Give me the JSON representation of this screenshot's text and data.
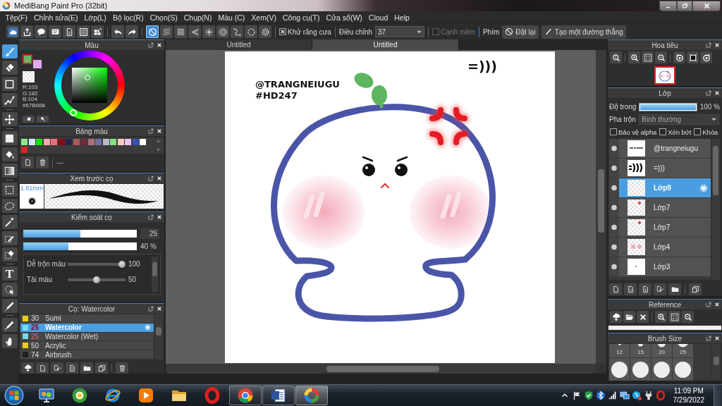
{
  "window": {
    "title": "MediBang Paint Pro (32bit)"
  },
  "menu": [
    "Tệp(F)",
    "Chỉnh sửa(E)",
    "Lớp(L)",
    "Bộ lọc(R)",
    "Chọn(S)",
    "Chụp(N)",
    "Màu (C)",
    "Xem(V)",
    "Công cụ(T)",
    "Cửa sổ(W)",
    "Cloud",
    "Help"
  ],
  "toolbar": {
    "snaps": [
      {
        "selected": true
      },
      {
        "selected": false
      },
      {
        "selected": false
      },
      {
        "selected": false
      },
      {
        "selected": false
      },
      {
        "selected": false
      },
      {
        "selected": false
      },
      {
        "selected": false
      },
      {
        "selected": false
      }
    ],
    "antialias": {
      "label": "Khử răng cưa",
      "checked": true
    },
    "correction": {
      "label": "Điều chỉnh",
      "value": "37"
    },
    "soft_edge": {
      "label": "Cạnh mềm",
      "checked": false,
      "disabled": true
    },
    "keys_label": "Phím",
    "reset_button": "Đặt lại",
    "line_button": "Tạo một đường thẳng"
  },
  "tools": {
    "groups": [
      [
        {
          "selected": true
        },
        {
          "selected": false
        },
        {
          "selected": false
        },
        {
          "selected": false
        }
      ],
      [
        {
          "selected": false
        }
      ],
      [
        {
          "selected": false
        },
        {
          "selected": false
        },
        {
          "selected": false
        }
      ],
      [
        {
          "selected": false
        },
        {
          "selected": false
        },
        {
          "selected": false
        },
        {
          "selected": false
        },
        {
          "selected": false
        }
      ],
      [
        {
          "selected": false,
          "glyph": "T"
        },
        {
          "selected": false
        },
        {
          "selected": false
        }
      ],
      [
        {
          "selected": false
        },
        {
          "selected": false
        }
      ]
    ]
  },
  "color_panel": {
    "title": "Màu",
    "foreground": {
      "color": "#67b668",
      "selected": true
    },
    "background": {
      "color": "#e0a8f0",
      "selected": false
    },
    "readout": [
      "R:103",
      "G:182",
      "B:104",
      "#67B668"
    ]
  },
  "palette": {
    "title": "Bảng màu",
    "swatches": [
      {
        "color": "#8fe88f"
      },
      {
        "color": "#d4eafa"
      },
      {
        "color": "#10e010"
      },
      {
        "color": "#f4a8b0"
      },
      {
        "color": "#e8707c"
      },
      {
        "color": "#8a0a14"
      },
      {
        "color": "#23234e"
      },
      {
        "color": "#a85a5a"
      },
      {
        "color": "#6e2c36"
      },
      {
        "color": "#a87272"
      },
      {
        "color": "#7070a0"
      },
      {
        "color": "#b8b8c8"
      },
      {
        "color": "#84e484"
      },
      {
        "color": "#fcccc4"
      },
      {
        "color": "#e8c4f4"
      },
      {
        "color": "#3454b4"
      },
      {
        "color": "#ffffff"
      },
      {
        "color": "#d42828"
      }
    ],
    "name": "---"
  },
  "brush_preview": {
    "title": "Xem trước cọ",
    "size": "1.81mm"
  },
  "brush_control": {
    "title": "Kiểm soát cọ",
    "size": {
      "level": 0.5,
      "value": "25"
    },
    "opacity": {
      "level": 0.4,
      "value": "40 %"
    },
    "params": [
      {
        "label": "Dễ trộn màu",
        "level": 1,
        "value": "100"
      },
      {
        "label": "Tải màu",
        "level": 0.5,
        "value": "50"
      }
    ]
  },
  "brushes": {
    "title": "Cọ: Watercolor",
    "items": [
      {
        "size": "30",
        "name": "Sumi",
        "color": "#e8d010",
        "size_marked": false,
        "selected": false
      },
      {
        "size": "25",
        "name": "Watercolor",
        "color": "#7ad8f0",
        "size_marked": true,
        "selected": true
      },
      {
        "size": "25",
        "name": "Watercolor (Wet)",
        "color": "#7ad8f0",
        "size_marked": true,
        "selected": false
      },
      {
        "size": "50",
        "name": "Acrylic",
        "color": "#e8d010",
        "size_marked": false,
        "selected": false
      },
      {
        "size": "74",
        "name": "Airbrush",
        "color": "#1e1e1e",
        "size_marked": false,
        "selected": false
      }
    ]
  },
  "tabs": [
    {
      "label": "Untitled",
      "selected": false
    },
    {
      "label": "Untitled",
      "selected": true
    }
  ],
  "canvas": {
    "handle": "@TRANGNEIUGU",
    "tag": "#HD247",
    "emote": "=)))"
  },
  "navigator": {
    "title": "Hoa tiêu"
  },
  "layers": {
    "title": "Lớp",
    "opacity": {
      "label": "Độ trong",
      "level": 1,
      "value": "100 %"
    },
    "blend": {
      "label": "Pha trộn",
      "value": "Bình thường"
    },
    "options": [
      {
        "label": "Bảo vệ alpha",
        "checked": false
      },
      {
        "label": "Xén bớt",
        "checked": false
      },
      {
        "label": "Khóa",
        "checked": false
      }
    ],
    "items": [
      {
        "name": "@trangneiugu",
        "kind": "handle",
        "selected": false
      },
      {
        "name": "=)))",
        "kind": "emote",
        "selected": false
      },
      {
        "name": "Lớp9",
        "kind": "empty",
        "selected": true
      },
      {
        "name": "Lớp7",
        "kind": "mark",
        "selected": false
      },
      {
        "name": "Lớp7",
        "kind": "mark",
        "selected": false
      },
      {
        "name": "Lớp4",
        "kind": "blush",
        "selected": false
      },
      {
        "name": "Lớp3",
        "kind": "sketch",
        "selected": false
      }
    ]
  },
  "reference": {
    "title": "Reference"
  },
  "brush_size": {
    "title": "Brush Size",
    "sizes": [
      "12",
      "15",
      "20",
      "25"
    ]
  },
  "taskbar": {
    "apps": [
      {
        "running": false,
        "selected": false
      },
      {
        "running": false,
        "selected": false
      },
      {
        "running": false,
        "selected": false
      },
      {
        "running": false,
        "selected": false
      },
      {
        "running": false,
        "selected": false
      },
      {
        "running": false,
        "selected": false
      },
      {
        "running": true,
        "selected": false
      },
      {
        "running": true,
        "selected": false
      },
      {
        "running": true,
        "selected": true
      }
    ],
    "time": "11:09 PM",
    "date": "7/29/2022"
  }
}
